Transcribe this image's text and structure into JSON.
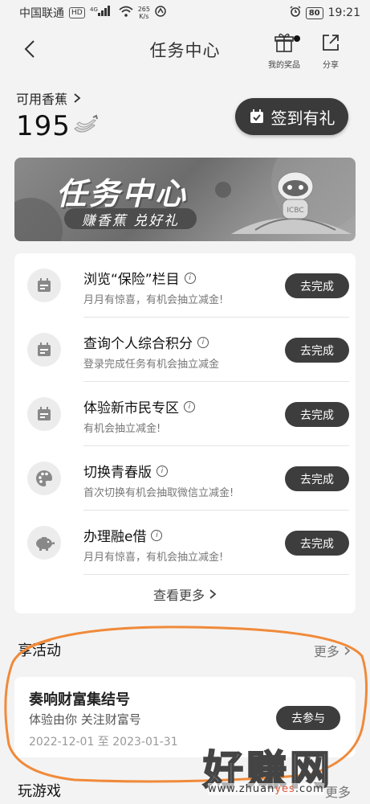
{
  "status_bar": {
    "carrier": "中国联通",
    "hd": "HD",
    "net": "4G",
    "speed_value": "265",
    "speed_unit": "K/s",
    "battery": "80",
    "time": "19:21"
  },
  "nav": {
    "title": "任务中心",
    "prizes_label": "我的奖品",
    "share_label": "分享"
  },
  "account": {
    "banana_label": "可用香蕉",
    "banana_count": "195",
    "checkin_label": "签到有礼"
  },
  "banner": {
    "title": "任务中心",
    "subtitle": "赚香蕉 兑好礼",
    "logo_text": "ICBC"
  },
  "tasks": [
    {
      "title": "浏览“保险”栏目",
      "desc": "月月有惊喜，有机会抽立减金!",
      "button": "去完成",
      "icon": "calendar-icon"
    },
    {
      "title": "查询个人综合积分",
      "desc": "登录完成任务有机会抽立减金",
      "button": "去完成",
      "icon": "calendar-icon"
    },
    {
      "title": "体验新市民专区",
      "desc": "有机会抽立减金!",
      "button": "去完成",
      "icon": "calendar-icon"
    },
    {
      "title": "切换青春版",
      "desc": "首次切换有机会抽取微信立减金!",
      "button": "去完成",
      "icon": "palette-icon"
    },
    {
      "title": "办理融e借",
      "desc": "月月有惊喜，有机会抽立减金!",
      "button": "去完成",
      "icon": "piggy-bank-icon"
    }
  ],
  "see_more": "查看更多",
  "activities": {
    "title": "享活动",
    "more": "更多",
    "card": {
      "title": "奏响财富集结号",
      "subtitle": "体验由你 关注财富号",
      "date": "2022-12-01 至 2023-01-31",
      "button": "去参与"
    }
  },
  "games": {
    "title": "玩游戏",
    "more": "更多"
  },
  "watermark": {
    "big": "好赚网",
    "small_prefix": "www.zhuan",
    "small_highlight": "yes",
    "small_suffix": ".com"
  }
}
